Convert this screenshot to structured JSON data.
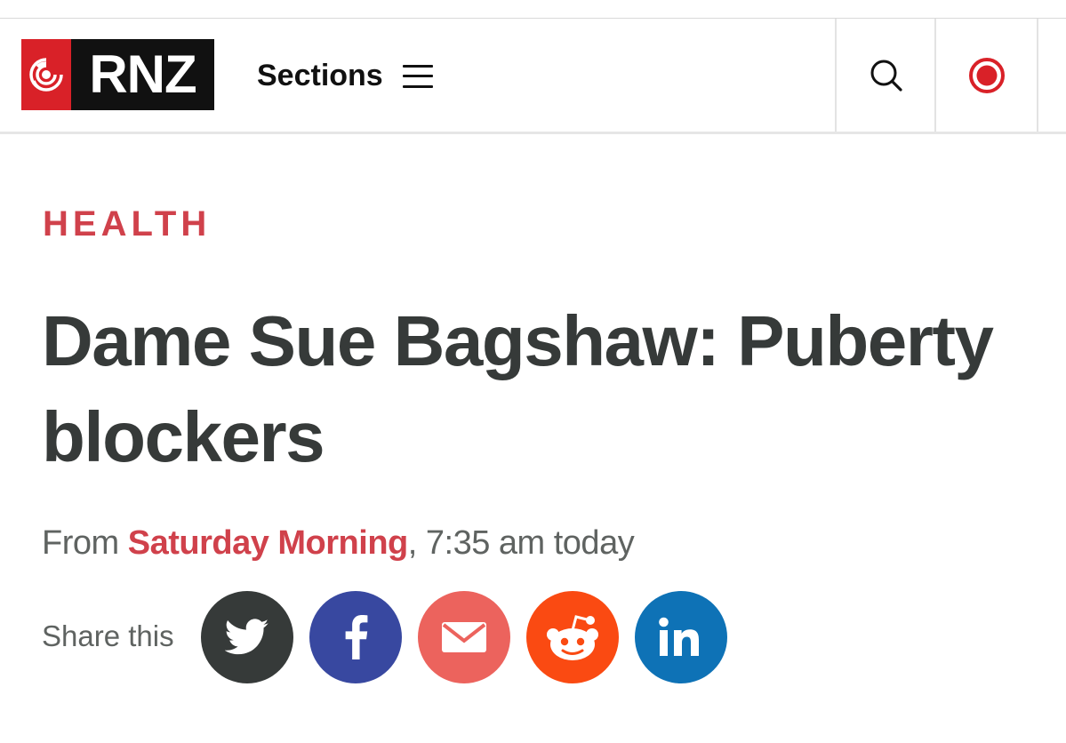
{
  "header": {
    "logo_text": "RNZ",
    "sections_label": "Sections",
    "icons": {
      "menu": "hamburger-menu-icon",
      "search": "search-icon",
      "live": "live-radio-icon"
    },
    "colors": {
      "brand_red": "#d92128",
      "logo_black": "#111111"
    }
  },
  "article": {
    "category": "HEALTH",
    "headline": "Dame Sue Bagshaw: Puberty blockers",
    "byline": {
      "from_label": "From",
      "program": "Saturday Morning",
      "separator": ",",
      "time": "7:35 am today"
    },
    "share": {
      "label": "Share this",
      "buttons": [
        {
          "service": "twitter",
          "icon": "twitter-bird-icon",
          "color": "#363a39"
        },
        {
          "service": "facebook",
          "icon": "facebook-icon",
          "color": "#3848a0"
        },
        {
          "service": "email",
          "icon": "envelope-icon",
          "color": "#ec635d"
        },
        {
          "service": "reddit",
          "icon": "reddit-alien-icon",
          "color": "#fa4a12"
        },
        {
          "service": "linkedin",
          "icon": "linkedin-icon",
          "color": "#0e72b6"
        }
      ]
    },
    "colors": {
      "accent": "#d0414b",
      "headline": "#363a39",
      "meta": "#5f6361"
    }
  }
}
